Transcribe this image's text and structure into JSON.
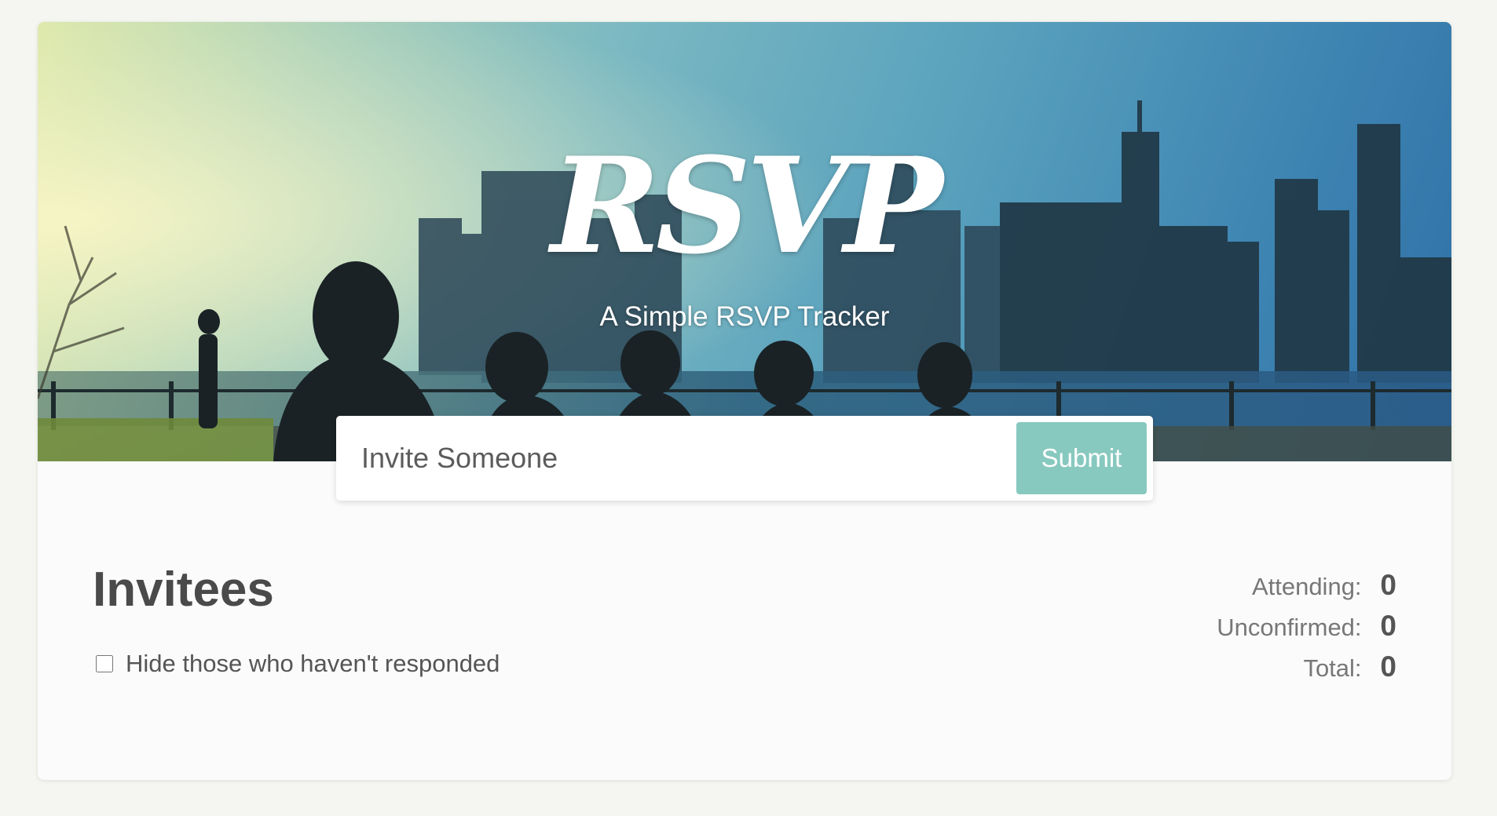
{
  "header": {
    "title": "RSVP",
    "subtitle": "A Simple RSVP Tracker"
  },
  "invite_form": {
    "placeholder": "Invite Someone",
    "value": "",
    "submit_label": "Submit"
  },
  "main": {
    "title": "Invitees",
    "filter_label": "Hide those who haven't responded",
    "filter_checked": false
  },
  "counter": {
    "items": [
      {
        "label": "Attending:",
        "value": "0"
      },
      {
        "label": "Unconfirmed:",
        "value": "0"
      },
      {
        "label": "Total:",
        "value": "0"
      }
    ]
  },
  "colors": {
    "accent": "#88c9bf",
    "page_background": "#f5f6f1",
    "card_background": "#fbfbfb",
    "text_dark": "#4a4a4a",
    "text_muted": "#777777"
  }
}
